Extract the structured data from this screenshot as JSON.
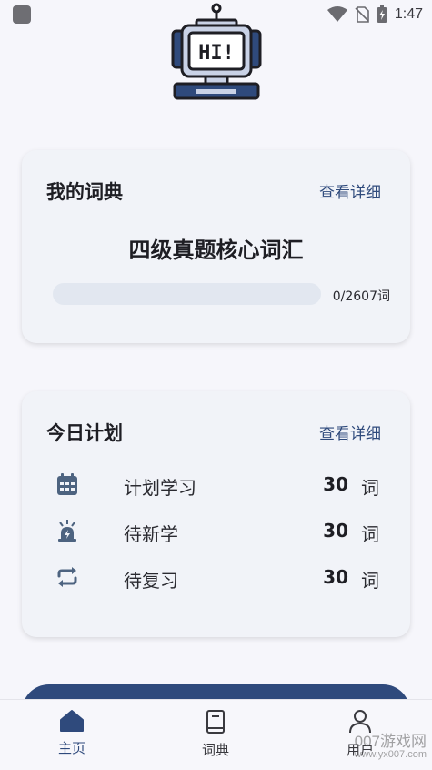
{
  "status_bar": {
    "time": "1:47",
    "icons": [
      "app-icon",
      "wifi-icon",
      "no-sim-icon",
      "battery-charging-icon"
    ]
  },
  "header": {
    "logo_text": "HI!",
    "logo_icon": "robot-icon"
  },
  "dictionary_card": {
    "title": "我的词典",
    "link": "查看详细",
    "dict_name": "四级真题核心词汇",
    "progress_label": "0/2607词",
    "progress_fraction": 0
  },
  "plan_card": {
    "title": "今日计划",
    "link": "查看详细",
    "rows": [
      {
        "icon": "calendar-icon",
        "label": "计划学习",
        "count": "30",
        "unit": "词"
      },
      {
        "icon": "alarm-icon",
        "label": "待新学",
        "count": "30",
        "unit": "词"
      },
      {
        "icon": "repeat-icon",
        "label": "待复习",
        "count": "30",
        "unit": "词"
      }
    ]
  },
  "bottom_nav": {
    "items": [
      {
        "label": "主页",
        "icon": "home-icon",
        "active": true
      },
      {
        "label": "词典",
        "icon": "book-icon",
        "active": false
      },
      {
        "label": "用户",
        "icon": "user-icon",
        "active": false
      }
    ]
  },
  "watermark": {
    "main": "007游戏网",
    "sub": "www.yx007.com"
  },
  "colors": {
    "accent": "#2f4a7c",
    "card_bg": "#f1f3f8",
    "page_bg": "#f6f6fb",
    "icon_color": "#4d6380"
  }
}
